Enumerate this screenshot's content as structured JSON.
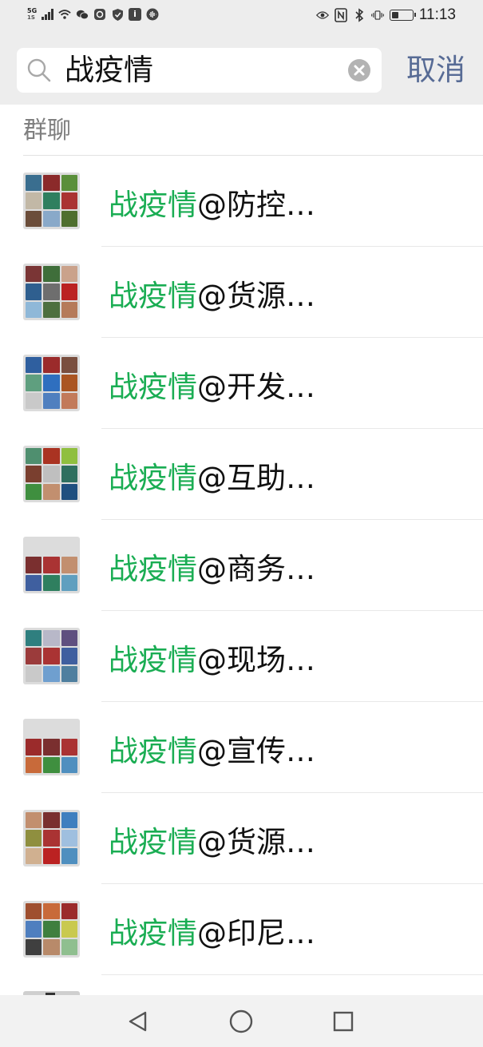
{
  "status_bar": {
    "network_label": "5G",
    "network_sub": "1S",
    "time": "11:13",
    "battery_level": 0.35,
    "left_icons": [
      "signal-icon",
      "wifi-icon",
      "wechat-icon",
      "message-icon",
      "shield-icon",
      "info-icon",
      "voice-icon"
    ],
    "right_icons": [
      "eye-icon",
      "nfc-icon",
      "bluetooth-icon",
      "vibrate-icon",
      "battery-icon"
    ]
  },
  "search": {
    "query": "战疫情",
    "cancel_label": "取消"
  },
  "section": {
    "title": "群聊"
  },
  "results": [
    {
      "highlight": "战疫情",
      "rest": "@防控…"
    },
    {
      "highlight": "战疫情",
      "rest": "@货源…"
    },
    {
      "highlight": "战疫情",
      "rest": "@开发…"
    },
    {
      "highlight": "战疫情",
      "rest": "@互助…"
    },
    {
      "highlight": "战疫情",
      "rest": "@商务…"
    },
    {
      "highlight": "战疫情",
      "rest": "@现场…"
    },
    {
      "highlight": "战疫情",
      "rest": "@宣传…"
    },
    {
      "highlight": "战疫情",
      "rest": "@货源…"
    },
    {
      "highlight": "战疫情",
      "rest": "@印尼…"
    }
  ],
  "colors": {
    "highlight": "#1aad53",
    "cancel": "#576b95",
    "header_bg": "#ededed",
    "section_label": "#7f7f7f"
  },
  "nav": {
    "buttons": [
      "back-triangle-icon",
      "home-circle-icon",
      "recents-square-icon"
    ]
  }
}
